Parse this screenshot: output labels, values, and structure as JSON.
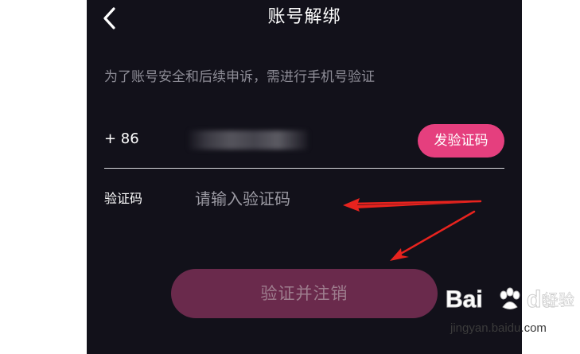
{
  "header": {
    "title": "账号解绑",
    "back_icon": "chevron-left-icon"
  },
  "notice": "为了账号安全和后续申诉，需进行手机号验证",
  "phone_field": {
    "country_code": "+ 86",
    "send_code_label": "发验证码"
  },
  "code_field": {
    "label": "验证码",
    "placeholder": "请输入验证码",
    "value": ""
  },
  "submit": {
    "label": "验证并注销"
  },
  "annotation": {
    "arrow_color": "#e8231e"
  },
  "watermark": {
    "brand_left": "Bai",
    "brand_right": "du",
    "suffix": "经验",
    "url": "jingyan.baidu.com"
  },
  "colors": {
    "screen_bg": "#12111a",
    "accent": "#e53f7e",
    "disabled_button": "#6a2a4c"
  }
}
